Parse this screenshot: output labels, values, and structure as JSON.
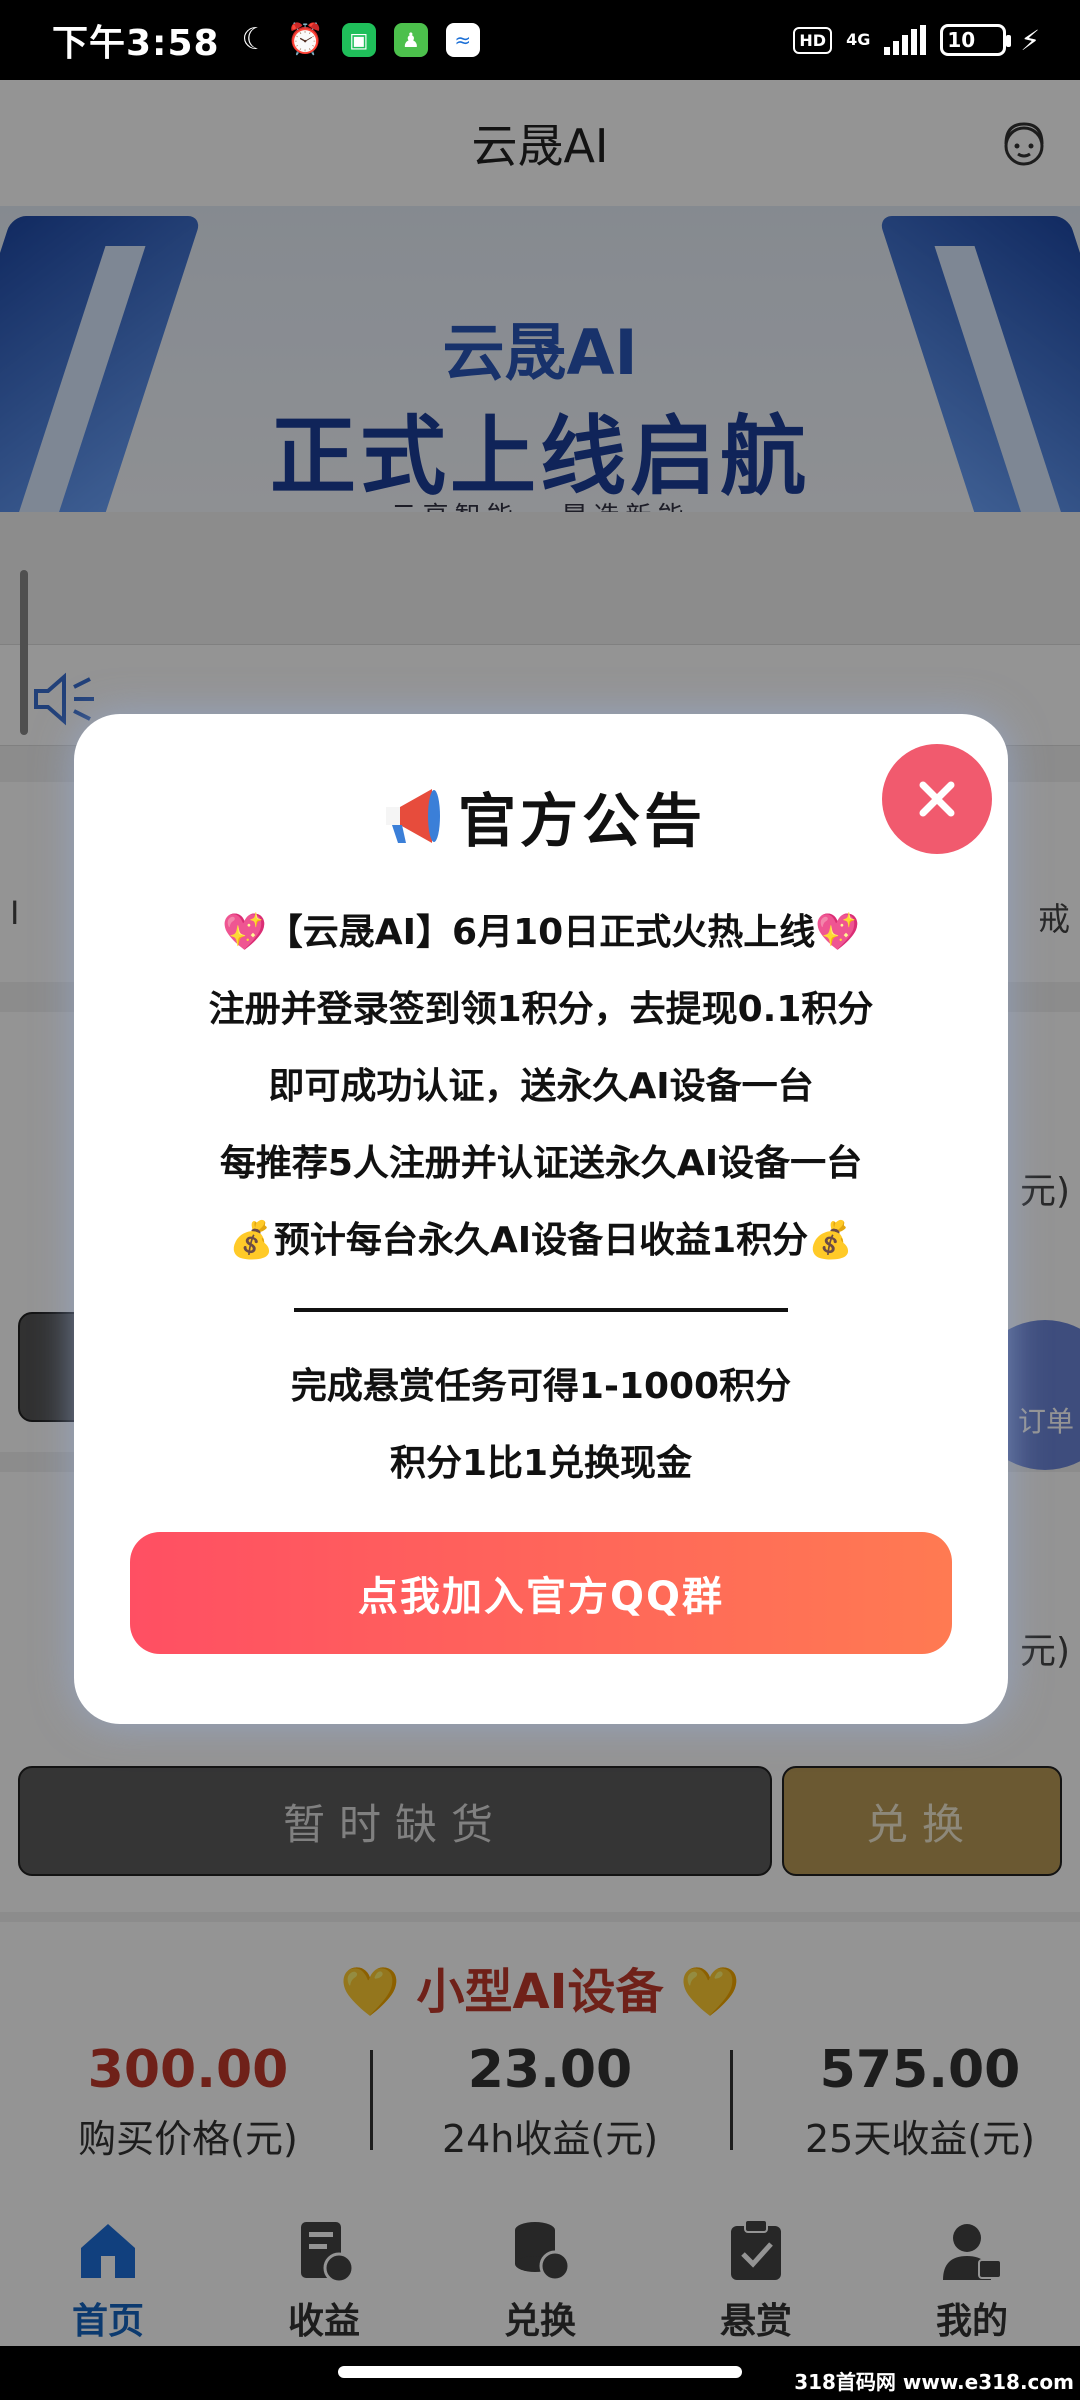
{
  "status_bar": {
    "time": "下午3:58",
    "hd": "HD",
    "network": "4G",
    "battery": "10"
  },
  "header": {
    "title": "云晟AI"
  },
  "banner": {
    "line1": "云晟AI",
    "line2": "正式上线启航",
    "line3": "云享智能 · 晟造新能"
  },
  "page": {
    "menu_left_fragment": "I",
    "menu_right_fragment": "戒",
    "unit_fragment": "元)",
    "float_button_label": "订单",
    "sold_out_button": "暂时缺货",
    "exchange_button": "兑换",
    "small_device": {
      "title": "💛 小型AI设备 💛",
      "price": "300.00",
      "price_label": "购买价格(元)",
      "daily_income": "23.00",
      "daily_income_label": "24h收益(元)",
      "period_income": "575.00",
      "period_income_label": "25天收益(元)"
    }
  },
  "bottom_nav": {
    "items": [
      {
        "label": "首页",
        "icon": "home-icon"
      },
      {
        "label": "收益",
        "icon": "income-icon"
      },
      {
        "label": "兑换",
        "icon": "exchange-icon"
      },
      {
        "label": "悬赏",
        "icon": "reward-icon"
      },
      {
        "label": "我的",
        "icon": "profile-icon"
      }
    ]
  },
  "modal": {
    "title": "官方公告",
    "lines": [
      "💖【云晟AI】6月10日正式火热上线💖",
      "注册并登录签到领1积分，去提现0.1积分",
      "即可成功认证，送永久AI设备一台",
      "每推荐5人注册并认证送永久AI设备一台",
      "💰预计每台永久AI设备日收益1积分💰"
    ],
    "lines2": [
      "完成悬赏任务可得1-1000积分",
      "积分1比1兑换现金"
    ],
    "join_button": "点我加入官方QQ群"
  },
  "watermark": "318首码网 www.e318.com",
  "colors": {
    "accent_red": "#f15a6e",
    "button_gradient_start": "#ff4f63",
    "button_gradient_end": "#ff7a52",
    "nav_active": "#1565c0"
  }
}
